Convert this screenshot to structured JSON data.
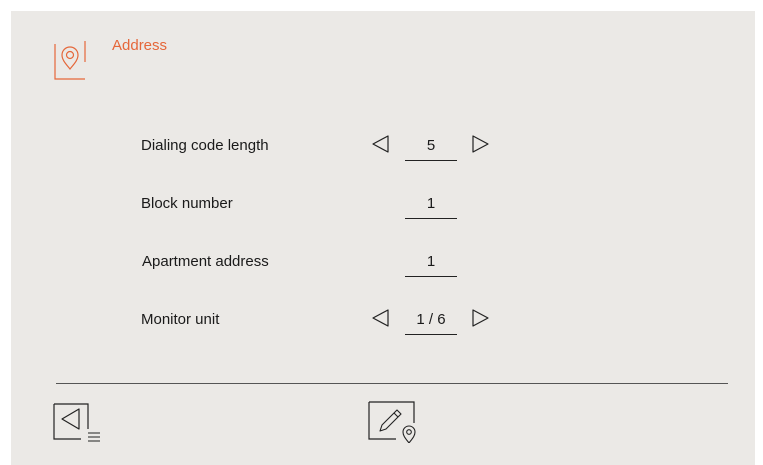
{
  "header": {
    "title": "Address",
    "icon": "location-pin-icon",
    "accent_color": "#e5673a"
  },
  "rows": [
    {
      "label": "Dialing code length",
      "value": "5",
      "adjustable": true
    },
    {
      "label": "Block number",
      "value": "1",
      "adjustable": false
    },
    {
      "label": "Apartment address",
      "value": "1",
      "adjustable": false
    },
    {
      "label": "Monitor unit",
      "value": "1 / 6",
      "adjustable": true
    }
  ],
  "footer": {
    "back_icon": "back-list-icon",
    "edit_icon": "edit-location-icon"
  }
}
